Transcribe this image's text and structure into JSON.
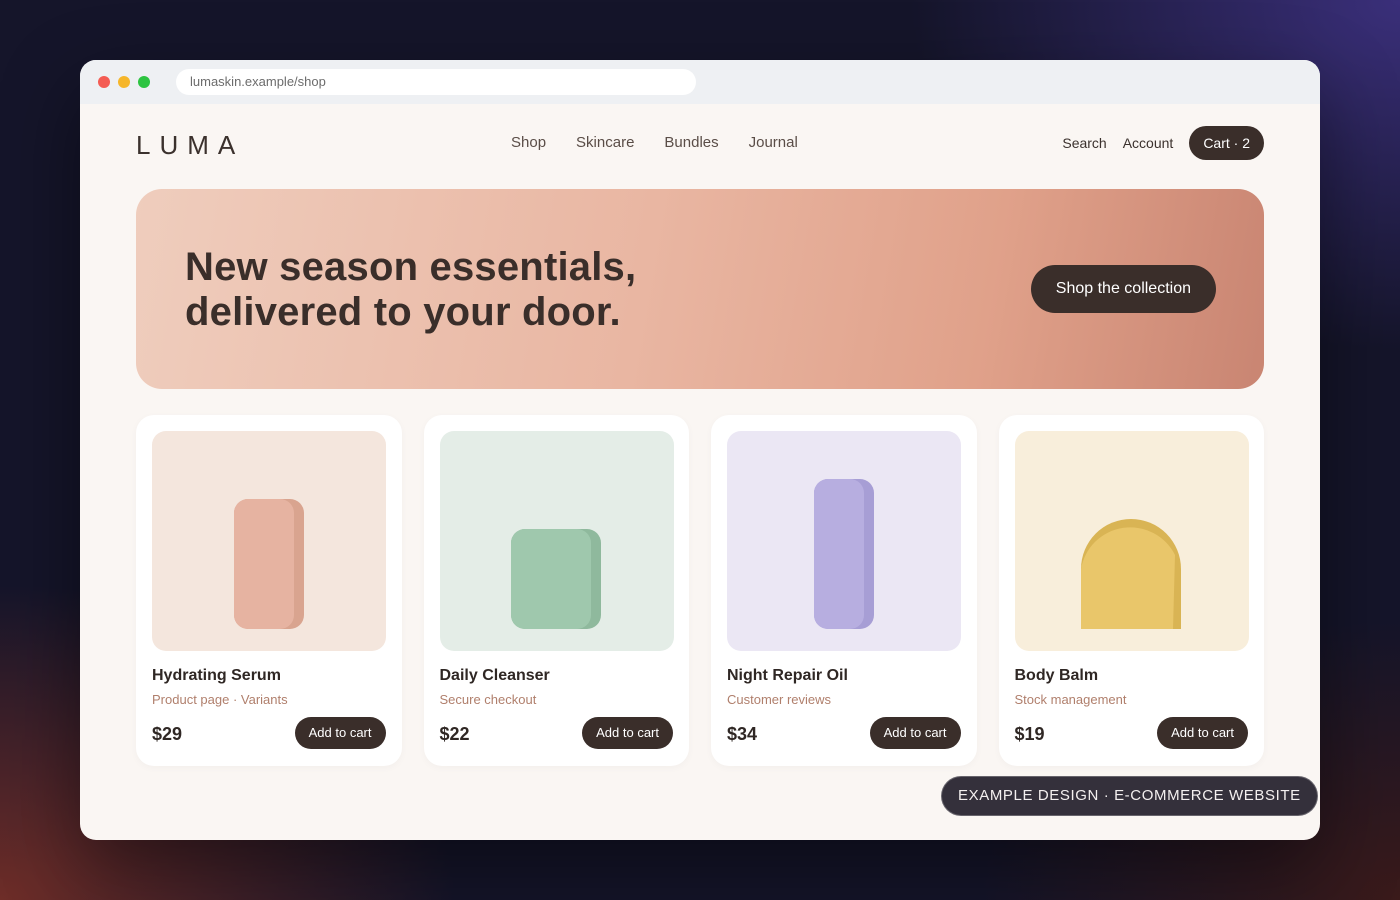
{
  "browser": {
    "url": "lumaskin.example/shop"
  },
  "nav": {
    "logo": "LUMA",
    "links": [
      "Shop",
      "Skincare",
      "Bundles",
      "Journal"
    ],
    "search_label": "Search",
    "account_label": "Account",
    "cart_label": "Cart · 2"
  },
  "hero": {
    "headline_line1": "New season essentials,",
    "headline_line2": "delivered to your door.",
    "cta_label": "Shop the collection"
  },
  "products": [
    {
      "name": "Hydrating Serum",
      "subtitle": "Product page · Variants",
      "price": "$29",
      "button": "Add to cart",
      "bg_color": "#f4e6dd",
      "product_color": "#e6b3a1",
      "icon": "serum-bottle-icon"
    },
    {
      "name": "Daily Cleanser",
      "subtitle": "Secure checkout",
      "price": "$22",
      "button": "Add to cart",
      "bg_color": "#e4ede7",
      "product_color": "#9fc8ad",
      "icon": "cleanser-jar-icon"
    },
    {
      "name": "Night Repair Oil",
      "subtitle": "Customer reviews",
      "price": "$34",
      "button": "Add to cart",
      "bg_color": "#ebe7f4",
      "product_color": "#b7aee0",
      "icon": "oil-bottle-icon"
    },
    {
      "name": "Body Balm",
      "subtitle": "Stock management",
      "price": "$19",
      "button": "Add to cart",
      "bg_color": "#f8eedb",
      "product_color": "#e9c66a",
      "icon": "balm-tub-icon"
    }
  ],
  "footer_badge": "EXAMPLE DESIGN · E-COMMERCE WEBSITE",
  "colors": {
    "primary_dark": "#3a2e2a",
    "page_bg": "#faf6f3",
    "subtitle_accent": "#b07f6c"
  }
}
